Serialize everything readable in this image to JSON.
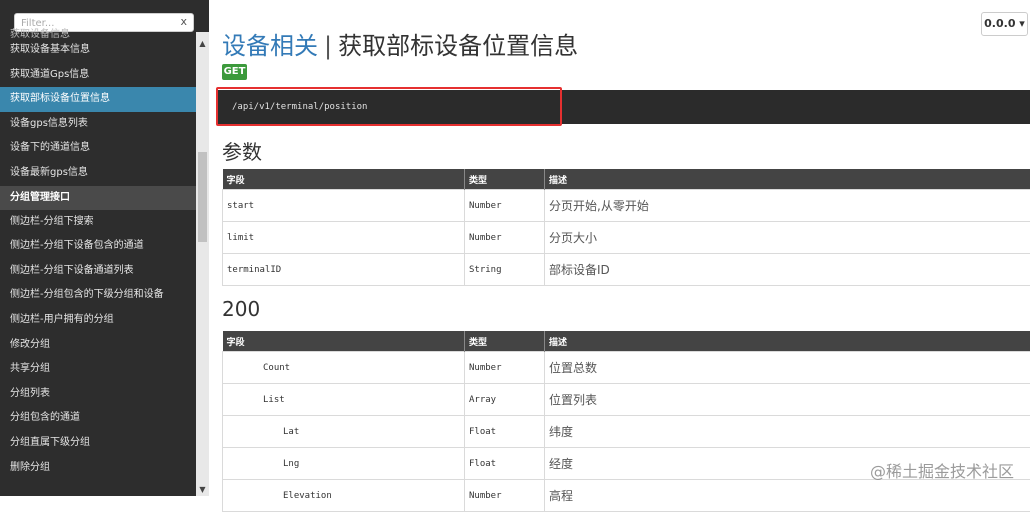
{
  "sidebar": {
    "filter_placeholder": "Filter...",
    "filter_clear": "x",
    "items": [
      {
        "label": "获取设备信息",
        "kind": "cut"
      },
      {
        "label": "获取设备基本信息",
        "kind": "item"
      },
      {
        "label": "获取通道Gps信息",
        "kind": "item"
      },
      {
        "label": "获取部标设备位置信息",
        "kind": "active"
      },
      {
        "label": "设备gps信息列表",
        "kind": "item"
      },
      {
        "label": "设备下的通道信息",
        "kind": "item"
      },
      {
        "label": "设备最新gps信息",
        "kind": "item"
      },
      {
        "label": "分组管理接口",
        "kind": "group"
      },
      {
        "label": "侧边栏-分组下搜索",
        "kind": "item"
      },
      {
        "label": "侧边栏-分组下设备包含的通道",
        "kind": "item"
      },
      {
        "label": "侧边栏-分组下设备通道列表",
        "kind": "item"
      },
      {
        "label": "侧边栏-分组包含的下级分组和设备",
        "kind": "item"
      },
      {
        "label": "侧边栏-用户拥有的分组",
        "kind": "item"
      },
      {
        "label": "修改分组",
        "kind": "item"
      },
      {
        "label": "共享分组",
        "kind": "item"
      },
      {
        "label": "分组列表",
        "kind": "item"
      },
      {
        "label": "分组包含的通道",
        "kind": "item"
      },
      {
        "label": "分组直属下级分组",
        "kind": "item"
      },
      {
        "label": "删除分组",
        "kind": "item"
      }
    ]
  },
  "header": {
    "version": "0.0.0 ▾",
    "group": "设备相关",
    "separator": "|",
    "title": "获取部标设备位置信息",
    "method": "GET",
    "path": "/api/v1/terminal/position"
  },
  "params": {
    "title": "参数",
    "columns": [
      "字段",
      "类型",
      "描述"
    ],
    "rows": [
      {
        "field": "start",
        "type": "Number",
        "desc": "分页开始,从零开始"
      },
      {
        "field": "limit",
        "type": "Number",
        "desc": "分页大小"
      },
      {
        "field": "terminalID",
        "type": "String",
        "desc": "部标设备ID"
      }
    ]
  },
  "response": {
    "title": "200",
    "columns": [
      "字段",
      "类型",
      "描述"
    ],
    "rows": [
      {
        "field": "Count",
        "type": "Number",
        "desc": "位置总数"
      },
      {
        "field": "List",
        "type": "Array",
        "desc": "位置列表"
      },
      {
        "field": "Lat",
        "type": "Float",
        "desc": "纬度"
      },
      {
        "field": "Lng",
        "type": "Float",
        "desc": "经度"
      },
      {
        "field": "Elevation",
        "type": "Number",
        "desc": "高程"
      }
    ]
  },
  "watermark": "@稀土掘金技术社区"
}
